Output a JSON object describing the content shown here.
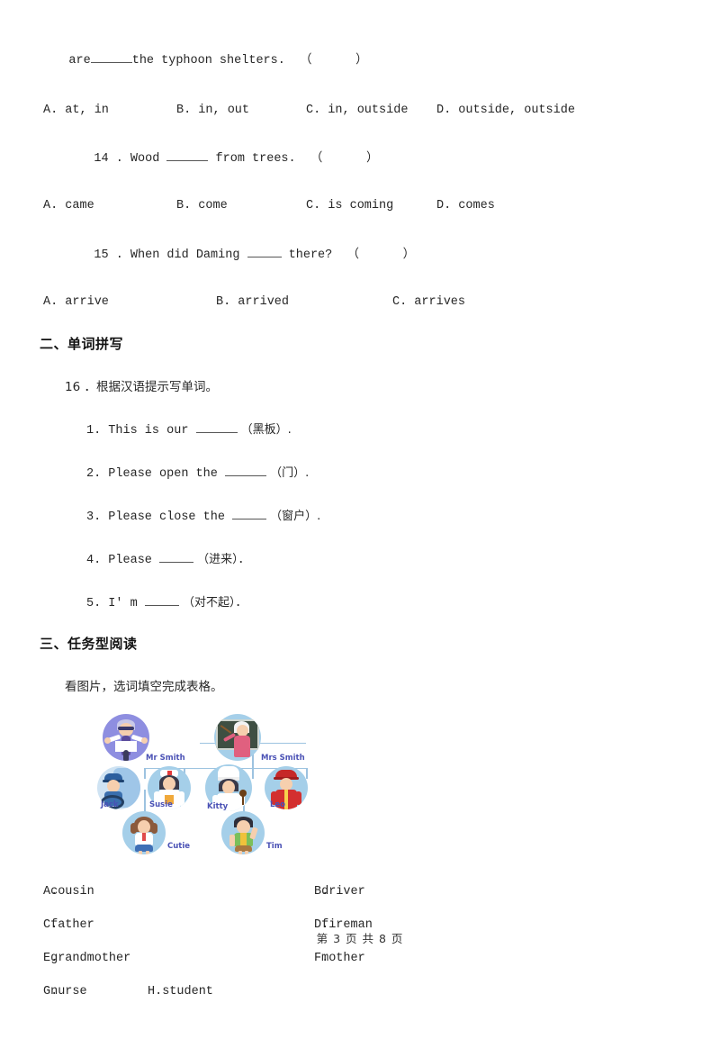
{
  "document": {
    "page_footer": "第 3 页 共 8 页"
  },
  "carryover_question": {
    "stem_prefix": "are",
    "stem_suffix": "the typhoon shelters.  （      ）",
    "options": [
      "A. at, in",
      "B. in, out",
      "C. in, outside",
      "D. outside, outside"
    ]
  },
  "questions": [
    {
      "number": "14 .",
      "stem_before": " Wood ",
      "stem_after": " from trees.  （      ）",
      "options": [
        "A. came",
        "B. come",
        "C. is coming",
        "D. comes"
      ]
    },
    {
      "number": "15 .",
      "stem_before": " When did Daming ",
      "stem_after": " there?  （      ）",
      "options": [
        "A. arrive",
        "B. arrived",
        "C. arrives"
      ]
    }
  ],
  "section_two": {
    "heading": "二、单词拼写",
    "instruction_number": "16 ．",
    "instruction": "根据汉语提示写单词。",
    "items": [
      {
        "num": "1.",
        "before": " This is our ",
        "after": " （黑板）."
      },
      {
        "num": "2.",
        "before": " Please open the ",
        "after": " （门）."
      },
      {
        "num": "3.",
        "before": " Please close the ",
        "after": " （窗户）."
      },
      {
        "num": "4.",
        "before": " Please ",
        "after": " （进来）．"
      },
      {
        "num": "5.",
        "before": " I' m ",
        "after": " （对不起）．"
      }
    ]
  },
  "section_three": {
    "heading": "三、任务型阅读",
    "instruction": "看图片，选词填空完成表格。",
    "figure": {
      "alt": "family-tree-picture",
      "circle_color": "#a5cfe9",
      "label_color": "#4a51b5",
      "link_color": "#9dc3e0",
      "people": [
        {
          "name": "Mr Smith",
          "role": "grandfather-scientist"
        },
        {
          "name": "Mrs Smith",
          "role": "teacher-grandmother"
        },
        {
          "name": "Jack",
          "role": "driver"
        },
        {
          "name": "Susie",
          "role": "nurse"
        },
        {
          "name": "Kitty",
          "role": "cook"
        },
        {
          "name": "Leo",
          "role": "fireman"
        },
        {
          "name": "Cutie",
          "role": "student-girl"
        },
        {
          "name": "Tim",
          "role": "student-boy"
        }
      ]
    },
    "word_bank": [
      {
        "key": "A.",
        "word": "cousin"
      },
      {
        "key": "B.",
        "word": "driver"
      },
      {
        "key": "C.",
        "word": "father"
      },
      {
        "key": "D.",
        "word": "fireman"
      },
      {
        "key": "E.",
        "word": "grandmother"
      },
      {
        "key": "F.",
        "word": "mother"
      },
      {
        "key": "G.",
        "word": "nurse"
      },
      {
        "key": "H.",
        "word": "student"
      }
    ]
  }
}
